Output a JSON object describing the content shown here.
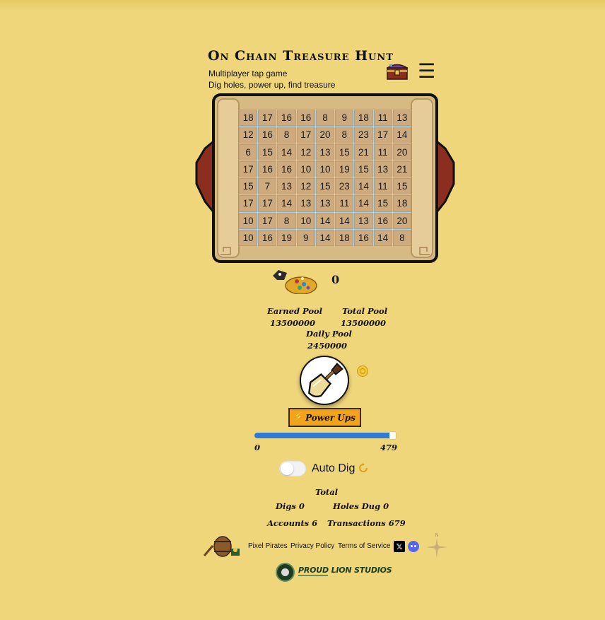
{
  "header": {
    "title": "On Chain Treasure Hunt",
    "subtitle_line1": "Multiplayer tap game",
    "subtitle_line2": "Dig holes, power up, find treasure",
    "menu_icon": "☰"
  },
  "board": {
    "rows": [
      [
        "18",
        "17",
        "16",
        "16",
        "8",
        "9",
        "18",
        "11",
        "13"
      ],
      [
        "12",
        "16",
        "8",
        "17",
        "20",
        "8",
        "23",
        "17",
        "14"
      ],
      [
        "6",
        "15",
        "14",
        "12",
        "13",
        "15",
        "21",
        "11",
        "20"
      ],
      [
        "17",
        "16",
        "16",
        "10",
        "10",
        "19",
        "15",
        "13",
        "21"
      ],
      [
        "15",
        "7",
        "13",
        "12",
        "15",
        "23",
        "14",
        "11",
        "15"
      ],
      [
        "17",
        "17",
        "14",
        "13",
        "13",
        "11",
        "14",
        "15",
        "18"
      ],
      [
        "10",
        "17",
        "8",
        "10",
        "14",
        "14",
        "13",
        "16",
        "20"
      ],
      [
        "10",
        "16",
        "19",
        "9",
        "14",
        "18",
        "16",
        "14",
        "8"
      ]
    ]
  },
  "treasure": {
    "count": "0"
  },
  "pools": {
    "earned_label": "Earned Pool",
    "earned_value": "13500000",
    "total_label": "Total Pool",
    "total_value": "13500000",
    "daily_label": "Daily Pool",
    "daily_value": "2450000"
  },
  "powerups": {
    "label": "Power Ups"
  },
  "energy": {
    "min": "0",
    "max": "479",
    "fraction": 0.98
  },
  "autodig": {
    "label": "Auto Dig",
    "enabled": false
  },
  "stats": {
    "total_label": "Total",
    "digs": "Digs 0",
    "holes": "Holes Dug 0",
    "accounts": "Accounts 6",
    "transactions": "Transactions 679"
  },
  "footer": {
    "links": [
      "Pixel Pirates",
      "Privacy Policy",
      "Terms of Service"
    ],
    "x_icon": "𝕏",
    "compass_north": "N",
    "brand": "PROUD LION STUDIOS"
  },
  "colors": {
    "background": "#efd67b",
    "grid_cell": "#cdab7e",
    "powerups": "#f3a21c",
    "progress": "#2f7bd6"
  }
}
